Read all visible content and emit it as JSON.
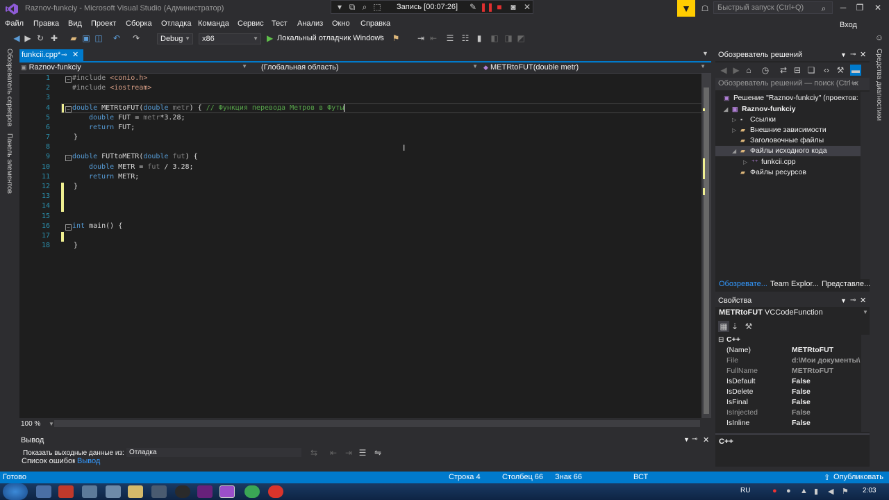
{
  "title": {
    "app_title": "Raznov-funkciy - Microsoft Visual Studio (Администратор)",
    "record": "Запись [00:07:26]",
    "quick_launch_placeholder": "Быстрый запуск (Ctrl+Q)",
    "login": "Вход"
  },
  "menu": [
    "Файл",
    "Правка",
    "Вид",
    "Проект",
    "Сборка",
    "Отладка",
    "Команда",
    "Сервис",
    "Тест",
    "Анализ",
    "Окно",
    "Справка"
  ],
  "toolbar": {
    "config": "Debug",
    "platform": "x86",
    "debugger": "Локальный отладчик Windows"
  },
  "doc_tab": {
    "name": "funkcii.cpp*"
  },
  "navbar": {
    "project": "Raznov-funkciy",
    "scope": "(Глобальная область)",
    "member": "METRtoFUT(double metr)"
  },
  "editor": {
    "line_numbers": [
      "1",
      "2",
      "3",
      "4",
      "5",
      "6",
      "7",
      "8",
      "9",
      "10",
      "11",
      "12",
      "13",
      "14",
      "15",
      "16",
      "17",
      "18"
    ],
    "line1_a": "#include ",
    "line1_b": "<conio.h>",
    "line2_a": "#include ",
    "line2_b": "<iostream>",
    "line4_kw": "double",
    "line4_fn": " METRtoFUT(",
    "line4_kw2": "double",
    "line4_pm": " metr",
    "line4_rest": ") { ",
    "line4_cm": "// Функция перевода Метров в Футы",
    "line5_kw": "double",
    "line5_a": " FUT = ",
    "line5_pm": "metr",
    "line5_b": "*3.28;",
    "line6_kw": "return",
    "line6_a": " FUT;",
    "line7": "}",
    "line9_kw": "double",
    "line9_fn": " FUTtoMETR(",
    "line9_kw2": "double",
    "line9_pm": " fut",
    "line9_rest": ") {",
    "line10_kw": "double",
    "line10_a": " METR = ",
    "line10_pm": "fut",
    "line10_b": " / 3.28;",
    "line11_kw": "return",
    "line11_a": " METR;",
    "line12": "}",
    "line16_kw": "int",
    "line16_a": " main() {",
    "line18": "}"
  },
  "zoom": "100 %",
  "output": {
    "title": "Вывод",
    "show_from": "Показать выходные данные из:",
    "source": "Отладка",
    "tab_errors": "Список ошибок",
    "tab_output": "Вывод"
  },
  "solution_explorer": {
    "title": "Обозреватель решений",
    "search_placeholder": "Обозреватель решений — поиск (Ctrl+к",
    "tree": [
      "Решение \"Raznov-funkciy\"  (проектов: 1)",
      "Raznov-funkciy",
      "Ссылки",
      "Внешние зависимости",
      "Заголовочные файлы",
      "Файлы исходного кода",
      "funkcii.cpp",
      "Файлы ресурсов"
    ],
    "tabs": [
      "Обозревате...",
      "Team Explor...",
      "Представле..."
    ]
  },
  "properties": {
    "title": "Свойства",
    "object": "METRtoFUT",
    "object_type": "VCCodeFunction",
    "category": "C++",
    "rows": [
      {
        "k": "(Name)",
        "v": "METRtoFUT"
      },
      {
        "k": "File",
        "v": "d:\\Мои документы\\"
      },
      {
        "k": "FullName",
        "v": "METRtoFUT"
      },
      {
        "k": "IsDefault",
        "v": "False"
      },
      {
        "k": "IsDelete",
        "v": "False"
      },
      {
        "k": "IsFinal",
        "v": "False"
      },
      {
        "k": "IsInjected",
        "v": "False"
      },
      {
        "k": "IsInline",
        "v": "False"
      }
    ],
    "footer": "C++"
  },
  "side_left": [
    "Обозреватель серверов",
    "Панель элементов"
  ],
  "side_right": [
    "Средства диагностики"
  ],
  "status": {
    "ready": "Готово",
    "row": "Строка 4",
    "col": "Столбец 66",
    "char": "Знак 66",
    "ins": "ВСТ",
    "publish": "Опубликовать"
  },
  "tray": {
    "lang": "RU",
    "time": "2:03"
  },
  "colors": {
    "accent": "#007acc",
    "bg": "#2d2d30",
    "editor": "#1e1e1e"
  }
}
